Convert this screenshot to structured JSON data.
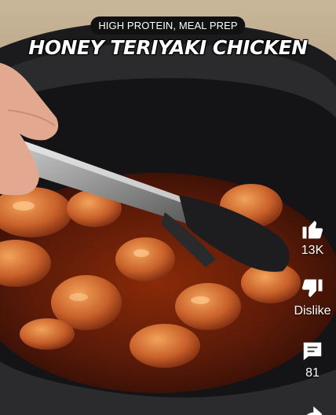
{
  "overlay": {
    "tag": "HIGH PROTEIN, MEAL PREP",
    "title": "HONEY TERIYAKI CHICKEN"
  },
  "actions": {
    "like_count": "13K",
    "dislike_label": "Dislike",
    "comments_count": "81"
  },
  "icons": {
    "like": "thumbs-up-icon",
    "dislike": "thumbs-down-icon",
    "comments": "comment-icon",
    "share": "share-icon"
  }
}
